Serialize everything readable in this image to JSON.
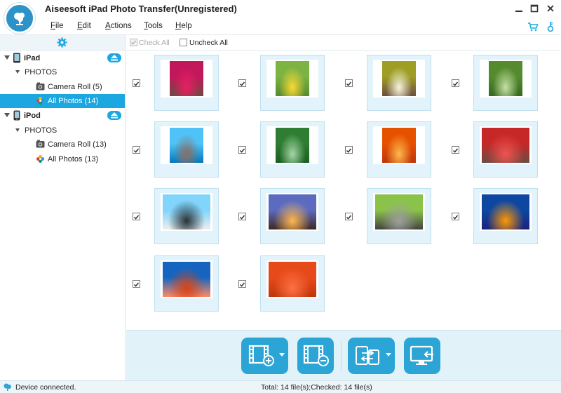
{
  "app": {
    "title": "Aiseesoft iPad Photo Transfer(Unregistered)",
    "accent": "#1ca7e0",
    "logo_icon": "tree-logo-icon"
  },
  "window_controls": [
    "minimize-icon",
    "maximize-icon",
    "close-icon"
  ],
  "menu": {
    "items": [
      {
        "label": "File",
        "key": "F"
      },
      {
        "label": "Edit",
        "key": "E"
      },
      {
        "label": "Actions",
        "key": "A"
      },
      {
        "label": "Tools",
        "key": "T"
      },
      {
        "label": "Help",
        "key": "H"
      }
    ],
    "right_icons": [
      "cart-icon",
      "key-icon"
    ]
  },
  "sidebar": {
    "header_icon": "gear-icon",
    "devices": [
      {
        "name": "iPad",
        "icon": "ipad-icon",
        "group": "PHOTOS",
        "albums": [
          {
            "label": "Camera Roll (5)",
            "icon": "camera-icon",
            "selected": false
          },
          {
            "label": "All Photos (14)",
            "icon": "photos-icon",
            "selected": true
          }
        ]
      },
      {
        "name": "iPod",
        "icon": "ipod-icon",
        "group": "PHOTOS",
        "albums": [
          {
            "label": "Camera Roll (13)",
            "icon": "camera-icon",
            "selected": false
          },
          {
            "label": "All Photos (13)",
            "icon": "photos-icon",
            "selected": false
          }
        ]
      }
    ]
  },
  "gridbar": {
    "check_all": "Check All",
    "check_all_enabled": false,
    "uncheck_all": "Uncheck All"
  },
  "photos": [
    {
      "subject": "pink tree alley",
      "orient": "portrait",
      "checked": true,
      "colors": [
        "#c2185b",
        "#e91e63",
        "#6d4c41"
      ]
    },
    {
      "subject": "park path",
      "orient": "portrait",
      "checked": true,
      "colors": [
        "#7cb342",
        "#fdd835",
        "#558b2f"
      ]
    },
    {
      "subject": "garden arch",
      "orient": "portrait",
      "checked": true,
      "colors": [
        "#9e9d24",
        "#f5f5dc",
        "#6d4c41"
      ]
    },
    {
      "subject": "green trail",
      "orient": "portrait",
      "checked": true,
      "colors": [
        "#558b2f",
        "#c5e1a5",
        "#33691e"
      ]
    },
    {
      "subject": "sea rock",
      "orient": "portrait",
      "checked": true,
      "colors": [
        "#4fc3f7",
        "#8d6e63",
        "#0277bd"
      ]
    },
    {
      "subject": "green forest",
      "orient": "portrait",
      "checked": true,
      "colors": [
        "#2e7d32",
        "#a5d6a7",
        "#1b5e20"
      ]
    },
    {
      "subject": "autumn path",
      "orient": "portrait",
      "checked": true,
      "colors": [
        "#e65100",
        "#ffb74d",
        "#bf360c"
      ]
    },
    {
      "subject": "red trees",
      "orient": "landscape",
      "checked": true,
      "colors": [
        "#c62828",
        "#ef5350",
        "#6d4c41"
      ]
    },
    {
      "subject": "penguins",
      "orient": "landscape",
      "checked": true,
      "colors": [
        "#81d4fa",
        "#263238",
        "#eceff1"
      ]
    },
    {
      "subject": "lighthouse",
      "orient": "landscape",
      "checked": true,
      "colors": [
        "#5c6bc0",
        "#ffb74d",
        "#3e2723"
      ]
    },
    {
      "subject": "koala",
      "orient": "landscape",
      "checked": true,
      "colors": [
        "#8bc34a",
        "#9e9e9e",
        "#424242"
      ]
    },
    {
      "subject": "jellyfish",
      "orient": "landscape",
      "checked": true,
      "colors": [
        "#0d47a1",
        "#ff9800",
        "#1a237e"
      ]
    },
    {
      "subject": "desert mesa",
      "orient": "landscape",
      "checked": true,
      "colors": [
        "#1565c0",
        "#d84315",
        "#ff8a65"
      ]
    },
    {
      "subject": "orange flower",
      "orient": "landscape",
      "checked": true,
      "colors": [
        "#e64a19",
        "#ff7043",
        "#bf360c"
      ]
    }
  ],
  "actions": [
    {
      "name": "add-photo-button",
      "icon": "film-plus-icon",
      "dropdown": true
    },
    {
      "name": "delete-photo-button",
      "icon": "film-minus-icon",
      "dropdown": false
    },
    {
      "name": "export-to-device-button",
      "icon": "phone-transfer-icon",
      "dropdown": true
    },
    {
      "name": "export-to-pc-button",
      "icon": "monitor-export-icon",
      "dropdown": false
    }
  ],
  "status": {
    "connection": "Device connected.",
    "summary": "Total: 14 file(s);Checked: 14 file(s)"
  }
}
